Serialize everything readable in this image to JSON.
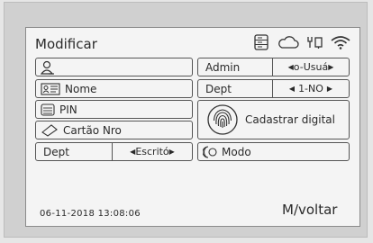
{
  "screen": {
    "title": "Modificar",
    "datetime": "06-11-2018  13:08:06",
    "back_label": "M/voltar"
  },
  "status_icons": [
    "storage-icon",
    "cloud-icon",
    "network-icon",
    "wifi-icon"
  ],
  "left_fields": {
    "user_id": "",
    "name_label": "Nome",
    "pin_label": "PIN",
    "card_label": "Cartão Nro",
    "dept_label": "Dept",
    "dept_value": "Escritó"
  },
  "right_fields": {
    "admin_label": "Admin",
    "admin_value": "o-Usuá",
    "dept_label": "Dept",
    "dept_value": "1-NO",
    "fingerprint_label": "Cadastrar digital",
    "mode_label": "Modo"
  },
  "colors": {
    "bezel": "#d0d0d0",
    "screen_bg": "#f4f4f4",
    "border": "#555555",
    "text": "#2a2a2a"
  }
}
